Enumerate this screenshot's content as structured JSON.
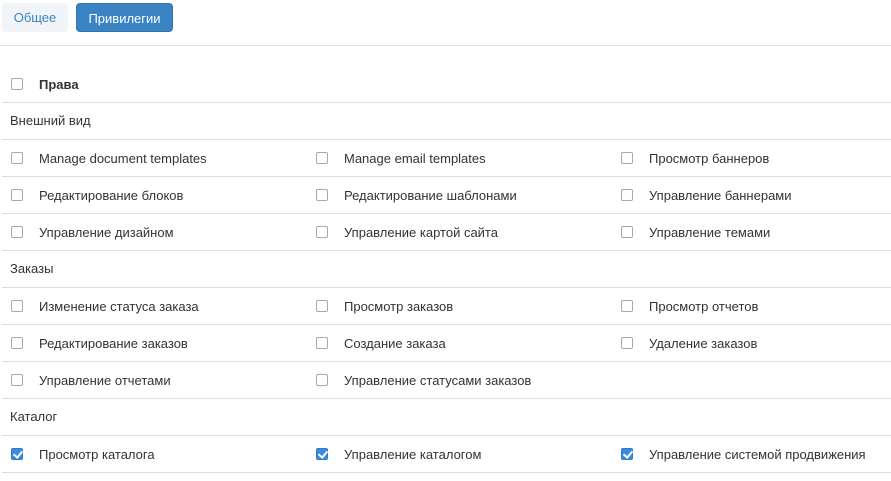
{
  "tabs": {
    "general": "Общее",
    "privileges": "Привилегии"
  },
  "table": {
    "header_label": "Права",
    "sections": [
      {
        "title": "Внешний вид",
        "rows": [
          [
            "Manage document templates",
            "Manage email templates",
            "Просмотр баннеров"
          ],
          [
            "Редактирование блоков",
            "Редактирование шаблонами",
            "Управление баннерами"
          ],
          [
            "Управление дизайном",
            "Управление картой сайта",
            "Управление темами"
          ]
        ]
      },
      {
        "title": "Заказы",
        "rows": [
          [
            "Изменение статуса заказа",
            "Просмотр заказов",
            "Просмотр отчетов"
          ],
          [
            "Редактирование заказов",
            "Создание заказа",
            "Удаление заказов"
          ],
          [
            "Управление отчетами",
            "Управление статусами заказов",
            ""
          ]
        ]
      },
      {
        "title": "Каталог",
        "rows": [
          [
            "Просмотр каталога",
            "Управление каталогом",
            "Управление системой продвижения"
          ]
        ],
        "checked": true
      }
    ]
  },
  "colors": {
    "accent": "#3a84c4",
    "checkbox_checked": "#3a8be0",
    "border": "#dddddd"
  }
}
